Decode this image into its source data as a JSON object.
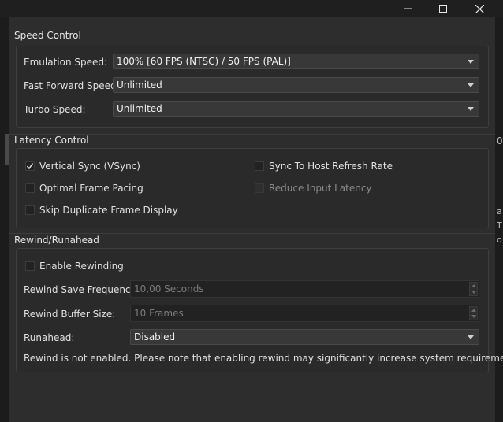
{
  "window": {
    "minimize_icon": "minimize-icon",
    "maximize_icon": "maximize-icon",
    "close_icon": "close-icon"
  },
  "speed_control": {
    "title": "Speed Control",
    "emulation_speed": {
      "label": "Emulation Speed:",
      "value": "100% [60 FPS (NTSC) / 50 FPS (PAL)]"
    },
    "fast_forward_speed": {
      "label": "Fast Forward Speed:",
      "value": "Unlimited"
    },
    "turbo_speed": {
      "label": "Turbo Speed:",
      "value": "Unlimited"
    }
  },
  "latency_control": {
    "title": "Latency Control",
    "vsync": {
      "label": "Vertical Sync (VSync)",
      "checked": true
    },
    "sync_host_refresh": {
      "label": "Sync To Host Refresh Rate",
      "checked": false
    },
    "optimal_frame_pacing": {
      "label": "Optimal Frame Pacing",
      "checked": false
    },
    "reduce_input_latency": {
      "label": "Reduce Input Latency",
      "checked": false,
      "enabled": false
    },
    "skip_duplicate_frame": {
      "label": "Skip Duplicate Frame Display",
      "checked": false
    }
  },
  "rewind": {
    "title": "Rewind/Runahead",
    "enable_rewinding": {
      "label": "Enable Rewinding",
      "checked": false
    },
    "save_frequency": {
      "label": "Rewind Save Frequency:",
      "value": "10,00 Seconds"
    },
    "buffer_size": {
      "label": "Rewind Buffer Size:",
      "value": "10 Frames"
    },
    "runahead": {
      "label": "Runahead:",
      "value": "Disabled"
    },
    "note": "Rewind is not enabled. Please note that enabling rewind may significantly increase system requirements."
  },
  "colors": {
    "background": "#2d2d2d",
    "titlebar": "#1f1f1f",
    "text": "#e0e0e0",
    "disabled_text": "#8a8a8a"
  }
}
